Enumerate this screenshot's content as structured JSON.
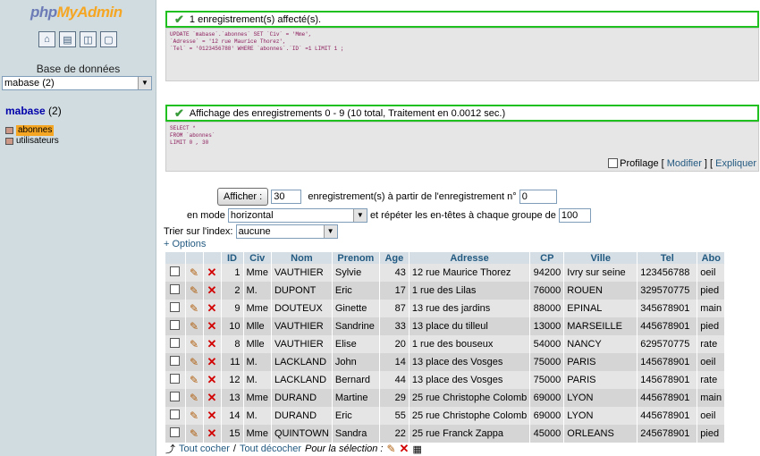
{
  "sidebar": {
    "logo_part1": "php",
    "logo_part2": "MyAdmin",
    "db_label": "Base de données",
    "db_select": "mabase (2)",
    "db_name": "mabase",
    "db_count": "(2)",
    "tables": [
      "abonnes",
      "utilisateurs"
    ]
  },
  "msg1": {
    "text": "1 enregistrement(s) affecté(s).",
    "sql": [
      "UPDATE `mabase`.`abonnes` SET `Civ` = 'Mme',",
      "`Adresse` = '12 rue Maurice Thorez',",
      "`Tel` = '0123456788' WHERE `abonnes`.`ID` =1 LIMIT 1 ;"
    ]
  },
  "msg2": {
    "text": "Affichage des enregistrements 0 - 9 (10 total, Traitement en 0.0012 sec.)",
    "sql": [
      "SELECT *",
      "FROM `abonnes`",
      "LIMIT 0 , 30"
    ],
    "profilage": "Profilage",
    "modifier": "Modifier",
    "expliquer": "Expliquer"
  },
  "controls": {
    "afficher": "Afficher :",
    "rows": "30",
    "from_text": "enregistrement(s) à partir de l'enregistrement n°",
    "start": "0",
    "mode_label": "en mode",
    "mode_value": "horizontal",
    "repeat_text": "et répéter les en-têtes à chaque groupe de",
    "repeat_value": "100",
    "sort_label": "Trier sur l'index:",
    "sort_value": "aucune",
    "options": "+ Options"
  },
  "table": {
    "columns": [
      "ID",
      "Civ",
      "Nom",
      "Prenom",
      "Age",
      "Adresse",
      "CP",
      "Ville",
      "Tel",
      "Abo"
    ],
    "rows": [
      [
        "1",
        "Mme",
        "VAUTHIER",
        "Sylvie",
        "43",
        "12 rue Maurice Thorez",
        "94200",
        "Ivry sur seine",
        "123456788",
        "oeil"
      ],
      [
        "2",
        "M.",
        "DUPONT",
        "Eric",
        "17",
        "1 rue des Lilas",
        "76000",
        "ROUEN",
        "329570775",
        "pied"
      ],
      [
        "9",
        "Mme",
        "DOUTEUX",
        "Ginette",
        "87",
        "13 rue des jardins",
        "88000",
        "EPINAL",
        "345678901",
        "main"
      ],
      [
        "10",
        "Mlle",
        "VAUTHIER",
        "Sandrine",
        "33",
        "13 place du tilleul",
        "13000",
        "MARSEILLE",
        "445678901",
        "pied"
      ],
      [
        "8",
        "Mlle",
        "VAUTHIER",
        "Elise",
        "20",
        "1 rue des bouseux",
        "54000",
        "NANCY",
        "629570775",
        "rate"
      ],
      [
        "11",
        "M.",
        "LACKLAND",
        "John",
        "14",
        "13 place des Vosges",
        "75000",
        "PARIS",
        "145678901",
        "oeil"
      ],
      [
        "12",
        "M.",
        "LACKLAND",
        "Bernard",
        "44",
        "13 place des Vosges",
        "75000",
        "PARIS",
        "145678901",
        "rate"
      ],
      [
        "13",
        "Mme",
        "DURAND",
        "Martine",
        "29",
        "25 rue Christophe Colomb",
        "69000",
        "LYON",
        "445678901",
        "main"
      ],
      [
        "14",
        "M.",
        "DURAND",
        "Eric",
        "55",
        "25 rue Christophe Colomb",
        "69000",
        "LYON",
        "445678901",
        "oeil"
      ],
      [
        "15",
        "Mme",
        "QUINTOWN",
        "Sandra",
        "22",
        "25 rue Franck Zappa",
        "45000",
        "ORLEANS",
        "245678901",
        "pied"
      ]
    ]
  },
  "footer": {
    "check_all": "Tout cocher",
    "sep": "/",
    "uncheck_all": "Tout décocher",
    "selection": "Pour la sélection :"
  }
}
